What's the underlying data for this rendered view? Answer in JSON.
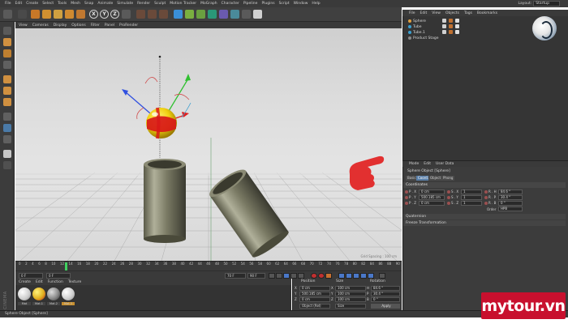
{
  "menubar": {
    "items": [
      "File",
      "Edit",
      "Create",
      "Select",
      "Tools",
      "Mesh",
      "Snap",
      "Animate",
      "Simulate",
      "Render",
      "Sculpt",
      "Motion Tracker",
      "MoGraph",
      "Character",
      "Pipeline",
      "Plugins",
      "Script",
      "Window",
      "Help"
    ],
    "layout_label": "Layout:",
    "layout_value": "Startup"
  },
  "toolbar": {
    "axis_x": "X",
    "axis_y": "Y",
    "axis_z": "Z"
  },
  "viewport": {
    "menu": [
      "View",
      "Cameras",
      "Display",
      "Options",
      "Filter",
      "Panel",
      "ProRender"
    ],
    "grid_spacing": "Grid Spacing : 100 cm"
  },
  "timeline": {
    "ticks": [
      "0",
      "2",
      "4",
      "6",
      "8",
      "10",
      "12",
      "14",
      "16",
      "18",
      "20",
      "22",
      "24",
      "26",
      "28",
      "30",
      "32",
      "34",
      "36",
      "38",
      "40",
      "42",
      "44",
      "46",
      "48",
      "50",
      "52",
      "54",
      "56",
      "58",
      "60",
      "62",
      "64",
      "66",
      "68",
      "70",
      "72",
      "74",
      "76",
      "78",
      "80",
      "82",
      "84",
      "86",
      "88",
      "90"
    ],
    "current_frame": "0 F",
    "start_frame": "0 F",
    "end_frame": "90 F",
    "max_frame": "90 F",
    "preview_max": "70 F"
  },
  "materials": {
    "menu": [
      "Create",
      "Edit",
      "Function",
      "Texture"
    ],
    "items": [
      {
        "label": "Mat",
        "color": "#e8e8e8"
      },
      {
        "label": "Mat.1",
        "color": "#e0b020"
      },
      {
        "label": "Mat.2",
        "color": "#8a8a8a"
      },
      {
        "label": "Mat.3",
        "color": "#d0d0d0"
      }
    ],
    "brand": "MAXON CINEMA 4D"
  },
  "coordinates": {
    "headers": [
      "Position",
      "Size",
      "Rotation"
    ],
    "rows": [
      {
        "axis": "X",
        "pos": "0 cm",
        "size": "100 cm",
        "rot_axis": "H",
        "rot": "84.6 °"
      },
      {
        "axis": "Y",
        "pos": "500.185 cm",
        "size": "100 cm",
        "rot_axis": "P",
        "rot": "30.4 °"
      },
      {
        "axis": "Z",
        "pos": "0 cm",
        "size": "100 cm",
        "rot_axis": "B",
        "rot": "0 °"
      }
    ],
    "mode_left": "Object (Rel)",
    "mode_right": "Size",
    "apply": "Apply"
  },
  "objects": {
    "menu": [
      "File",
      "Edit",
      "View",
      "Objects",
      "Tags",
      "Bookmarks"
    ],
    "items": [
      {
        "name": "Sphere",
        "color": "#e0a040"
      },
      {
        "name": "Tube",
        "color": "#3aa0d0"
      },
      {
        "name": "Tube.1",
        "color": "#3aa0d0"
      },
      {
        "name": "Product Stage",
        "color": "#888888"
      }
    ]
  },
  "attributes": {
    "menu": [
      "Mode",
      "Edit",
      "User Data"
    ],
    "title": "Sphere Object [Sphere]",
    "tabs": [
      "Basic",
      "Coord.",
      "Object",
      "Phong"
    ],
    "active_tab": "Coord.",
    "section": "Coordinates",
    "rows": [
      {
        "p_label": "P . X",
        "p_val": "0 cm",
        "s_label": "S . X",
        "s_val": "1",
        "r_label": "R . H",
        "r_val": "84.6 °"
      },
      {
        "p_label": "P . Y",
        "p_val": "500.185 cm",
        "s_label": "S . Y",
        "s_val": "1",
        "r_label": "R . P",
        "r_val": "30.4 °"
      },
      {
        "p_label": "P . Z",
        "p_val": "0 cm",
        "s_label": "S . Z",
        "s_val": "1",
        "r_label": "R . B",
        "r_val": "0 °"
      }
    ],
    "order_label": "Order",
    "order_value": "HPB",
    "collapsed": [
      "Quaternion",
      "Freeze Transformation"
    ]
  },
  "status": {
    "text": "Sphere Object [Sphere]"
  },
  "watermark": {
    "text": "mytour.vn"
  },
  "colors": {
    "accent_red": "#c8102e",
    "ui_dark": "#3a3a3a",
    "active_tab": "#5a7fa8"
  }
}
